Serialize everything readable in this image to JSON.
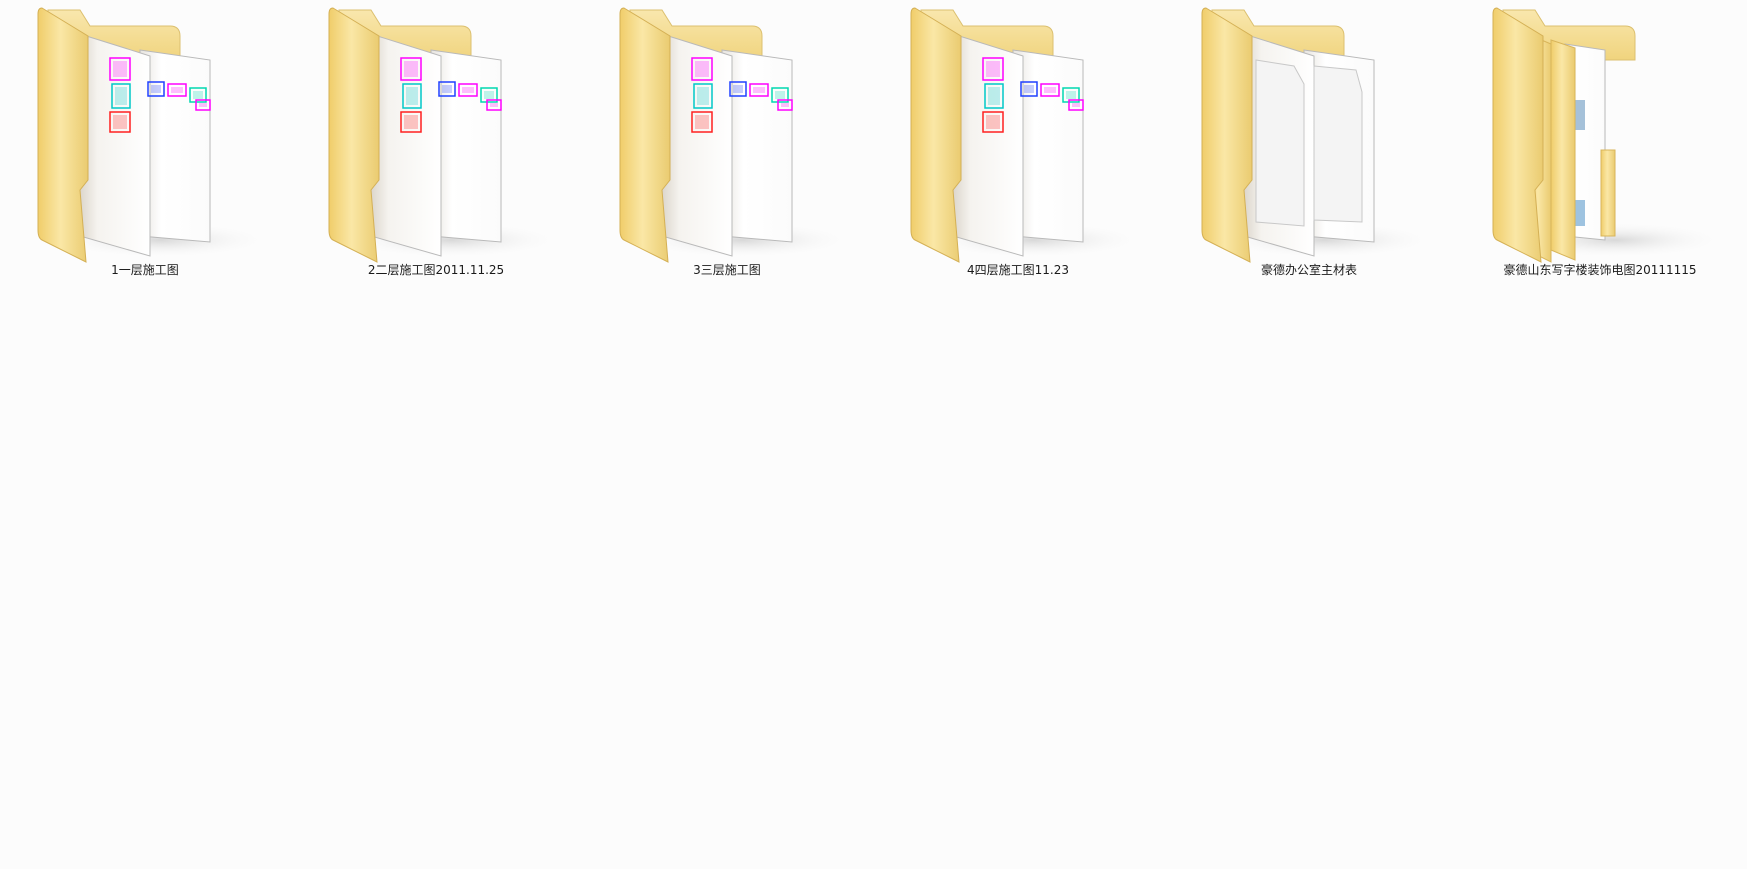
{
  "explorer": {
    "folders": [
      {
        "name": "1一层施工图",
        "icon": "folder-with-drawings-icon",
        "preview": "cad-drawings"
      },
      {
        "name": "2二层施工图2011.11.25",
        "icon": "folder-with-drawings-icon",
        "preview": "cad-drawings"
      },
      {
        "name": "3三层施工图",
        "icon": "folder-with-drawings-icon",
        "preview": "cad-drawings"
      },
      {
        "name": "4四层施工图11.23",
        "icon": "folder-with-drawings-icon",
        "preview": "cad-drawings"
      },
      {
        "name": "豪德办公室主材表",
        "icon": "folder-with-documents-icon",
        "preview": "blank-documents"
      },
      {
        "name": "豪德山东写字楼装饰电图20111115",
        "icon": "folder-with-booklets-icon",
        "preview": "booklets"
      }
    ]
  },
  "colors": {
    "background": "#fcfcfc",
    "folder_front": "#f4d77c",
    "folder_back": "#f7e3a3",
    "paper": "#ffffff"
  }
}
